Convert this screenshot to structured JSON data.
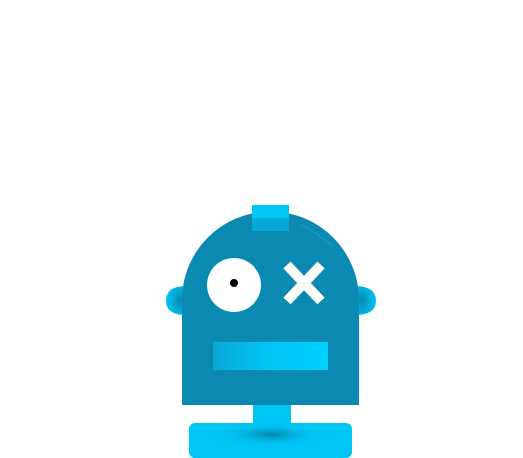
{
  "illustration": {
    "subject": "robot-head",
    "colors": {
      "background": "#ffffff",
      "head": "#0a8ab0",
      "accent": "#00c6f5",
      "eye_white": "#ffffff",
      "pupil": "#000000"
    },
    "icons": [
      "robot-icon",
      "eye-icon",
      "x-eye-icon",
      "antenna-icon",
      "ear-icon",
      "mouth-icon",
      "stand-icon"
    ]
  }
}
